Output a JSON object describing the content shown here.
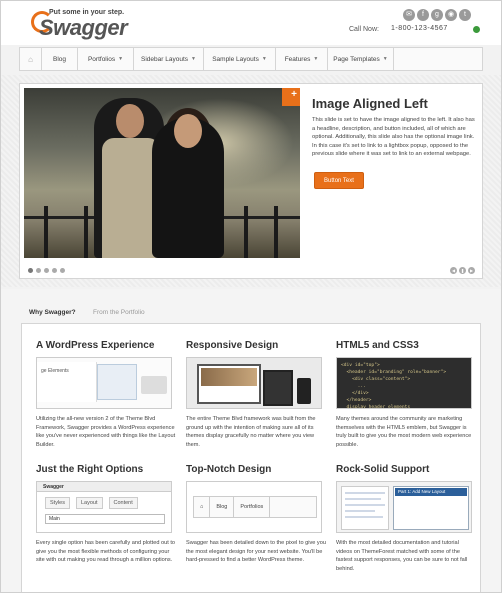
{
  "header": {
    "tagline": "Put some in your step.",
    "logo_text": "Swagger",
    "call_label": "Call Now:",
    "phone": "1-800-123-4567",
    "social_icons": [
      "email-icon",
      "facebook-icon",
      "google-icon",
      "rss-icon",
      "twitter-icon"
    ]
  },
  "nav": {
    "items": [
      {
        "label": "",
        "icon": "home-icon"
      },
      {
        "label": "Blog"
      },
      {
        "label": "Portfolios"
      },
      {
        "label": "Sidebar Layouts"
      },
      {
        "label": "Sample Layouts"
      },
      {
        "label": "Features"
      },
      {
        "label": "Page Templates"
      }
    ]
  },
  "slider": {
    "title": "Image Aligned Left",
    "description": "This slide is set to have the image aligned to the left. It also has a headline, description, and button included, all of which are optional. Additionally, this slide also has the optional image link. In this case it's set to link to a lightbox popup, opposed to the previous slide where it was set to link to an external webpage.",
    "button_label": "Button Text",
    "slide_count": 5,
    "active_slide": 1,
    "accent_color": "#e8701a"
  },
  "tabs": [
    {
      "label": "Why Swagger?",
      "active": true
    },
    {
      "label": "From the Portfolio",
      "active": false
    }
  ],
  "features": [
    {
      "title": "A WordPress Experience",
      "description": "Utilizing the all-new version 2 of the Theme Blvd Framework, Swagger provides a WordPress experience like you've never experienced with things like the Layout Builder.",
      "image_text": "ge Elements"
    },
    {
      "title": "Responsive Design",
      "description": "The entire Theme Blvd framework was built from the ground up with the intention of making sure all of its themes display gracefully no matter where you view them."
    },
    {
      "title": "HTML5 and CSS3",
      "description": "Many themes around the community are marketing themselves with the HTML5 emblem, but Swagger is truly built to give you the most modern web experience possible.",
      "image_text": "<div id=\"top\">\n  <header id=\"branding\" role=\"banner\">\n    <div class=\"content\">\n      ...\n    </div>\n  </header>\n  display header elements"
    },
    {
      "title": "Just the Right Options",
      "description": "Every single option has been carefully and plotted out to give you the most flexible methods of configuring your site with out making you read through a million options.",
      "image_text": {
        "brand": "Swagger",
        "tabs": [
          "Styles",
          "Layout",
          "Content"
        ],
        "field": "Main"
      }
    },
    {
      "title": "Top-Notch Design",
      "description": "Swagger has been detailed down to the pixel to give you the most elegant design for your next website. You'll be hard-pressed to find a better WordPress theme.",
      "image_text": [
        "Blog",
        "Portfolios"
      ]
    },
    {
      "title": "Rock-Solid Support",
      "description": "With the most detailed documentation and tutorial videos on ThemeForest matched with some of the fastest support responses, you can be sure to not fall behind.",
      "image_text": "Part 1: Add New Layout"
    }
  ]
}
